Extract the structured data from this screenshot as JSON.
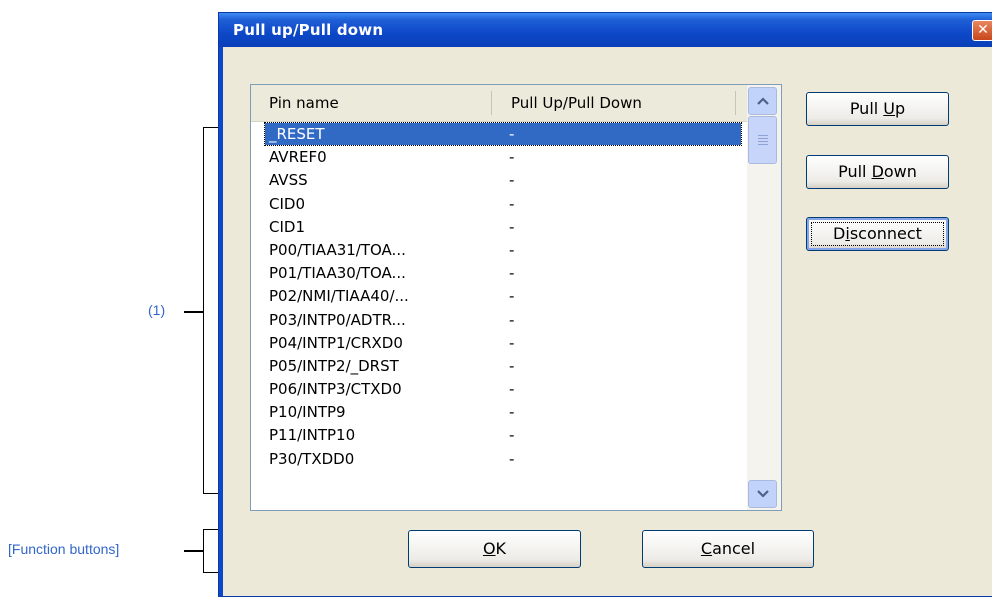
{
  "annotations": {
    "list_marker": "(1)",
    "function_buttons": "[Function buttons]"
  },
  "dialog": {
    "title": "Pull up/Pull down",
    "close_glyph": "✕"
  },
  "list": {
    "columns": [
      "Pin name",
      "Pull Up/Pull Down"
    ],
    "selected_index": 0,
    "rows": [
      {
        "pin": "_RESET",
        "state": "-"
      },
      {
        "pin": "AVREF0",
        "state": "-"
      },
      {
        "pin": "AVSS",
        "state": "-"
      },
      {
        "pin": "CID0",
        "state": "-"
      },
      {
        "pin": "CID1",
        "state": "-"
      },
      {
        "pin": "P00/TIAA31/TOA...",
        "state": "-"
      },
      {
        "pin": "P01/TIAA30/TOA...",
        "state": "-"
      },
      {
        "pin": "P02/NMI/TIAA40/...",
        "state": "-"
      },
      {
        "pin": "P03/INTP0/ADTR...",
        "state": "-"
      },
      {
        "pin": "P04/INTP1/CRXD0",
        "state": "-"
      },
      {
        "pin": "P05/INTP2/_DRST",
        "state": "-"
      },
      {
        "pin": "P06/INTP3/CTXD0",
        "state": "-"
      },
      {
        "pin": "P10/INTP9",
        "state": "-"
      },
      {
        "pin": "P11/INTP10",
        "state": "-"
      },
      {
        "pin": "P30/TXDD0",
        "state": "-"
      }
    ]
  },
  "scrollbar": {
    "up_icon": "chevron-up-icon",
    "down_icon": "chevron-down-icon"
  },
  "side_buttons": {
    "pull_up": {
      "pre": "Pull ",
      "key": "U",
      "post": "p"
    },
    "pull_down": {
      "pre": "Pull ",
      "key": "D",
      "post": "own"
    },
    "disconnect": {
      "pre": "D",
      "key": "i",
      "post": "sconnect"
    }
  },
  "bottom_buttons": {
    "ok": {
      "pre": "",
      "key": "O",
      "post": "K"
    },
    "cancel": {
      "pre": "",
      "key": "C",
      "post": "ancel"
    }
  }
}
